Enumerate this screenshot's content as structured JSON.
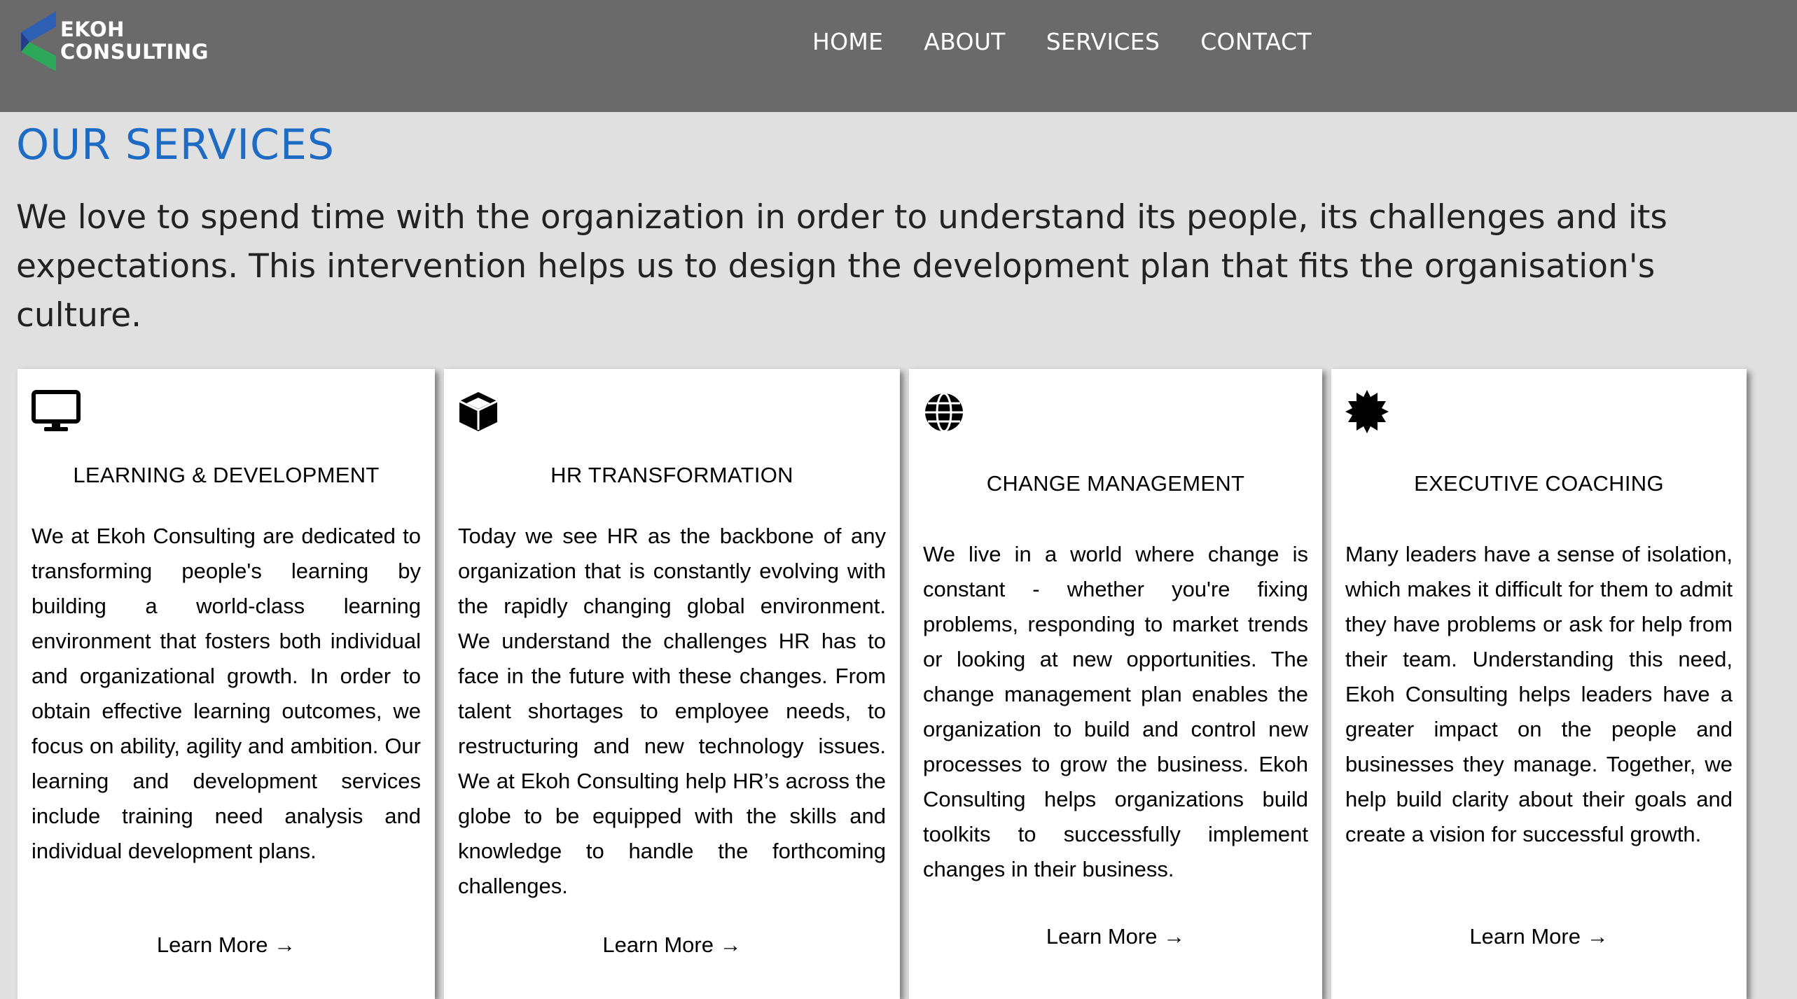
{
  "brand": {
    "line1": "EKOH",
    "line2": "CONSULTING",
    "colors": {
      "blue": "#2d5fb4",
      "green": "#2ea85a"
    }
  },
  "nav": {
    "items": [
      {
        "label": "HOME"
      },
      {
        "label": "ABOUT"
      },
      {
        "label": "SERVICES"
      },
      {
        "label": "CONTACT"
      }
    ]
  },
  "page": {
    "title": "OUR SERVICES",
    "intro": "We love to spend time with the organization in order to understand its people, its challenges and its expectations. This intervention helps us to design the development plan that fits the organisation's culture."
  },
  "services": [
    {
      "icon": "monitor-icon",
      "title": "LEARNING & DEVELOPMENT",
      "body": "We at Ekoh Consulting are dedicated to transforming people's learning by building a world-class learning environment that fosters both individual and organizational growth. In order to obtain effective learning outcomes, we focus on ability, agility and ambition. Our learning and development services include training need analysis and individual development plans.",
      "link": "Learn More →"
    },
    {
      "icon": "cube-icon",
      "title": "HR TRANSFORMATION",
      "body": "Today we see HR as the backbone of any organization that is constantly evolving with the rapidly changing global environment. We understand the challenges HR has to face in the future with these changes. From talent shortages to employee needs, to restructuring and new technology issues. We at Ekoh Consulting help HR’s across the globe to be equipped with the skills and knowledge to handle the forthcoming challenges.",
      "link": "Learn More →"
    },
    {
      "icon": "globe-icon",
      "title": "CHANGE MANAGEMENT",
      "body": "We live in a world where change is constant - whether you're fixing problems, responding to market trends or looking at new opportunities. The change management plan enables the organization to build and control new processes to grow the business. Ekoh Consulting helps organizations build toolkits to successfully implement changes in their business.",
      "link": "Learn More →"
    },
    {
      "icon": "certificate-icon",
      "title": "EXECUTIVE COACHING",
      "body": "Many leaders have a sense of isolation, which makes it difficult for them to admit they have problems or ask for help from their team. Understanding this need, Ekoh Consulting helps leaders have a greater impact on the people and businesses they manage. Together, we help build clarity about their goals and create a vision for successful growth.",
      "link": "Learn More →"
    }
  ]
}
